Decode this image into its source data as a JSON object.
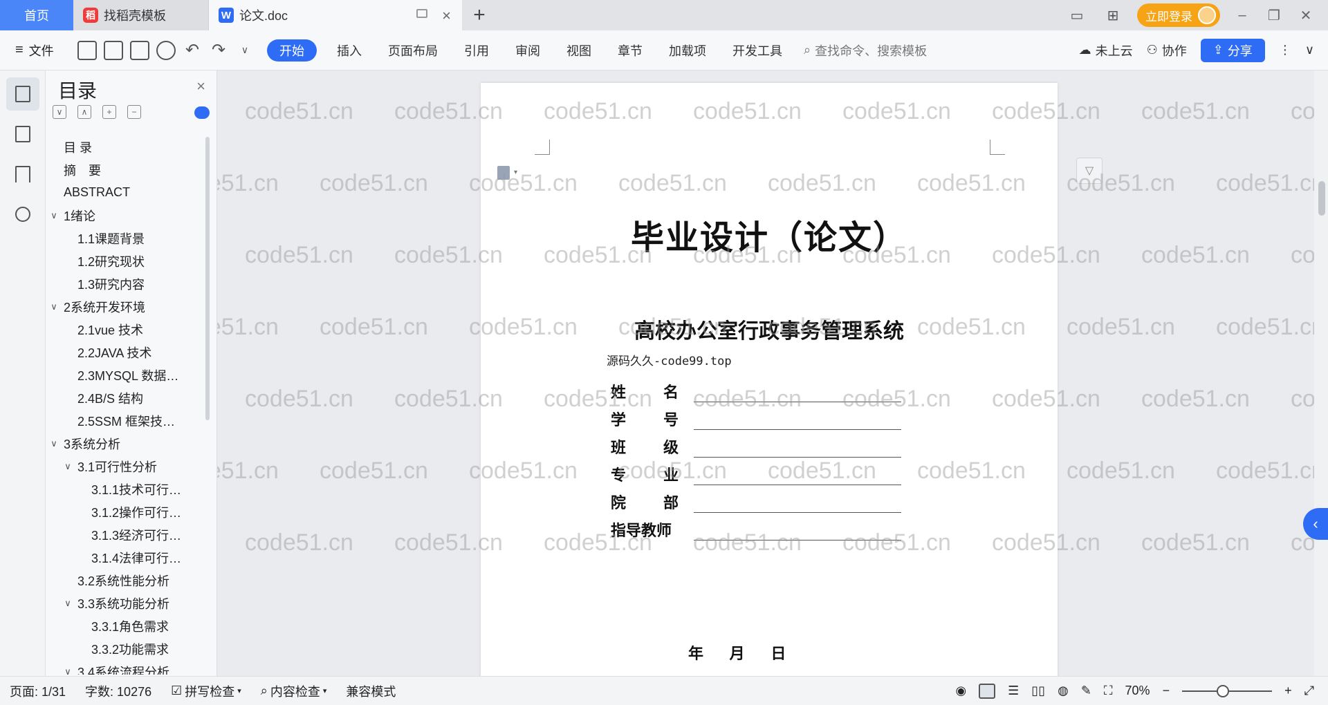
{
  "titlebar": {
    "home_tab": "首页",
    "template_tab": "找稻壳模板",
    "doc_tab": "论文.doc",
    "login_label": "立即登录"
  },
  "ribbon": {
    "file_label": "文件",
    "menus": [
      "开始",
      "插入",
      "页面布局",
      "引用",
      "审阅",
      "视图",
      "章节",
      "加载项",
      "开发工具"
    ],
    "search_placeholder": "查找命令、搜索模板",
    "cloud_label": "未上云",
    "collab_label": "协作",
    "share_label": "分享"
  },
  "toc": {
    "title": "目录",
    "items": [
      {
        "label": "目 录",
        "level": 1,
        "chev": ""
      },
      {
        "label": "摘　要",
        "level": 1,
        "chev": ""
      },
      {
        "label": "ABSTRACT",
        "level": 1,
        "chev": ""
      },
      {
        "label": "1绪论",
        "level": 1,
        "chev": "∨"
      },
      {
        "label": "1.1课题背景",
        "level": 2,
        "chev": ""
      },
      {
        "label": "1.2研究现状",
        "level": 2,
        "chev": ""
      },
      {
        "label": "1.3研究内容",
        "level": 2,
        "chev": ""
      },
      {
        "label": "2系统开发环境",
        "level": 1,
        "chev": "∨"
      },
      {
        "label": "2.1vue 技术",
        "level": 2,
        "chev": ""
      },
      {
        "label": "2.2JAVA 技术",
        "level": 2,
        "chev": ""
      },
      {
        "label": "2.3MYSQL 数据…",
        "level": 2,
        "chev": ""
      },
      {
        "label": "2.4B/S 结构",
        "level": 2,
        "chev": ""
      },
      {
        "label": "2.5SSM 框架技…",
        "level": 2,
        "chev": ""
      },
      {
        "label": "3系统分析",
        "level": 1,
        "chev": "∨"
      },
      {
        "label": "3.1可行性分析",
        "level": 2,
        "chev": "∨"
      },
      {
        "label": "3.1.1技术可行…",
        "level": 3,
        "chev": ""
      },
      {
        "label": "3.1.2操作可行…",
        "level": 3,
        "chev": ""
      },
      {
        "label": "3.1.3经济可行…",
        "level": 3,
        "chev": ""
      },
      {
        "label": "3.1.4法律可行…",
        "level": 3,
        "chev": ""
      },
      {
        "label": "3.2系统性能分析",
        "level": 2,
        "chev": ""
      },
      {
        "label": "3.3系统功能分析",
        "level": 2,
        "chev": "∨"
      },
      {
        "label": "3.3.1角色需求",
        "level": 3,
        "chev": ""
      },
      {
        "label": "3.3.2功能需求",
        "level": 3,
        "chev": ""
      },
      {
        "label": "3.4系统流程分析",
        "level": 2,
        "chev": "∨"
      }
    ]
  },
  "document": {
    "title": "毕业设计（论文）",
    "subtitle": "高校办公室行政事务管理系统",
    "source": "源码久久-code99.top",
    "fields": [
      {
        "label_a": "姓",
        "label_b": "名"
      },
      {
        "label_a": "学",
        "label_b": "号"
      },
      {
        "label_a": "班",
        "label_b": "级"
      },
      {
        "label_a": "专",
        "label_b": "业"
      },
      {
        "label_a": "院",
        "label_b": "部"
      },
      {
        "label_a": "指导教师",
        "label_b": ""
      }
    ],
    "date_line": "年 月 日"
  },
  "watermark": "code51.cn",
  "statusbar": {
    "page": "页面: 1/31",
    "words": "字数: 10276",
    "spell": "拼写检查",
    "content": "内容检查",
    "compat": "兼容模式",
    "zoom": "70%",
    "zoom_fraction": 0.45
  },
  "colors": {
    "accent": "#2f6cf5",
    "login": "#f6a316"
  }
}
